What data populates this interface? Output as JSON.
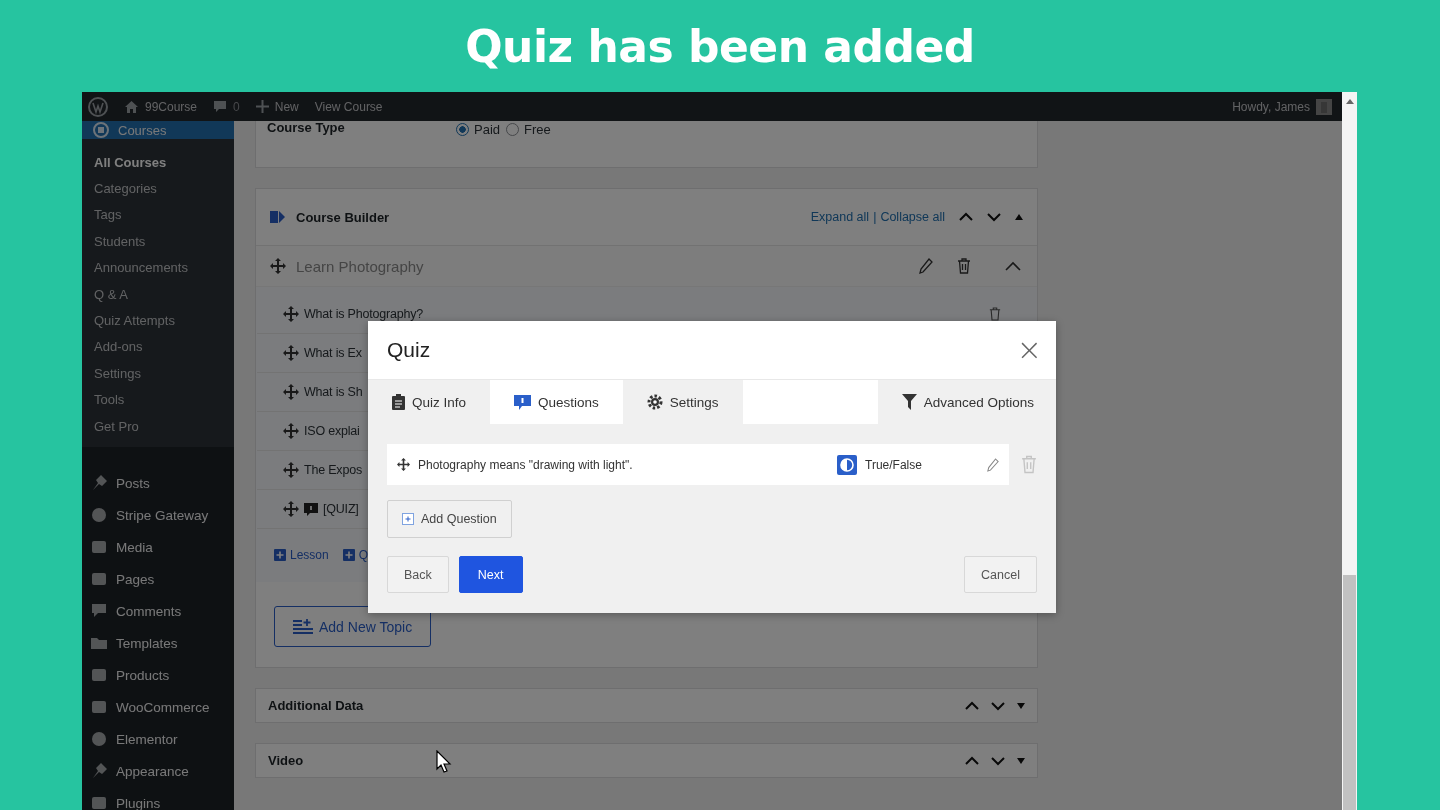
{
  "banner": {
    "title": "Quiz has been added"
  },
  "admin_bar": {
    "site": "99Course",
    "comments": "0",
    "new": "New",
    "view": "View Course",
    "greeting": "Howdy, James"
  },
  "sidebar": {
    "parent": {
      "label": "Courses",
      "selected": true
    },
    "submenu": [
      {
        "label": "All Courses",
        "selected": true
      },
      {
        "label": "Categories",
        "selected": false
      },
      {
        "label": "Tags",
        "selected": false
      },
      {
        "label": "Students",
        "selected": false
      },
      {
        "label": "Announcements",
        "selected": false
      },
      {
        "label": "Q & A",
        "selected": false
      },
      {
        "label": "Quiz Attempts",
        "selected": false
      },
      {
        "label": "Add-ons",
        "selected": false
      },
      {
        "label": "Settings",
        "selected": false
      },
      {
        "label": "Tools",
        "selected": false
      },
      {
        "label": "Get Pro",
        "selected": false
      }
    ],
    "menu": [
      {
        "label": "Posts"
      },
      {
        "label": "Stripe Gateway"
      },
      {
        "label": "Media"
      },
      {
        "label": "Pages"
      },
      {
        "label": "Comments"
      },
      {
        "label": "Templates"
      },
      {
        "label": "Products"
      },
      {
        "label": "WooCommerce"
      },
      {
        "label": "Elementor"
      },
      {
        "label": "Appearance"
      },
      {
        "label": "Plugins"
      }
    ]
  },
  "course_type": {
    "label": "Course Type",
    "options": [
      {
        "label": "Paid",
        "selected": true
      },
      {
        "label": "Free",
        "selected": false
      }
    ]
  },
  "builder": {
    "title": "Course Builder",
    "expand": "Expand all",
    "separator": "|",
    "collapse": "Collapse all",
    "topic": {
      "title": "Learn Photography"
    },
    "lessons": [
      {
        "title": "What is Photography?",
        "kind": "lesson"
      },
      {
        "title": "What is Ex",
        "kind": "lesson"
      },
      {
        "title": "What is Sh",
        "kind": "lesson"
      },
      {
        "title": "ISO explai",
        "kind": "lesson"
      },
      {
        "title": "The Expos",
        "kind": "lesson"
      },
      {
        "title": "[QUIZ]",
        "kind": "quiz"
      }
    ],
    "add_links": [
      "Lesson",
      "Q"
    ],
    "add_topic": "Add New Topic"
  },
  "sections": [
    {
      "title": "Additional Data"
    },
    {
      "title": "Video"
    }
  ],
  "modal": {
    "title": "Quiz",
    "close": "×",
    "tabs": [
      {
        "label": "Quiz Info",
        "selected": false
      },
      {
        "label": "Questions",
        "selected": true
      },
      {
        "label": "Settings",
        "selected": false
      },
      {
        "label": "Advanced Options",
        "selected": false
      }
    ],
    "question": {
      "text": "Photography means \"drawing with light\".",
      "type": "True/False"
    },
    "add_question": "Add Question",
    "back": "Back",
    "next": "Next",
    "cancel": "Cancel"
  }
}
